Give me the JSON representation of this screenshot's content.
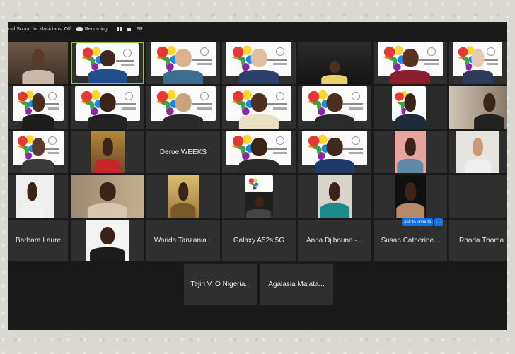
{
  "topbar": {
    "sound": "nal Sound for Musicians: Off",
    "recording": "Recording...",
    "lang": "FR"
  },
  "participants": {
    "deroe": "Deroe WEEKS",
    "barbara": "Barbara Laure",
    "warida": "Warida Tanzania...",
    "galaxy": "Galaxy A52s 5G",
    "anna": "Anna Djiboune -...",
    "susan": "Susan Catherine...",
    "rhoda": "Rhoda Thoma",
    "tejiri": "Tejiri V. O Nigeria...",
    "agalasia": "Agalasia Malata..."
  },
  "popover": {
    "ask_to_unmute": "Ask to unmute",
    "more": "···"
  },
  "colors": {
    "tile_bg": "#2f2f2f",
    "screen_bg": "#1a1a1a",
    "active_speaker": "#8bc34a",
    "accent": "#0e72ed"
  }
}
